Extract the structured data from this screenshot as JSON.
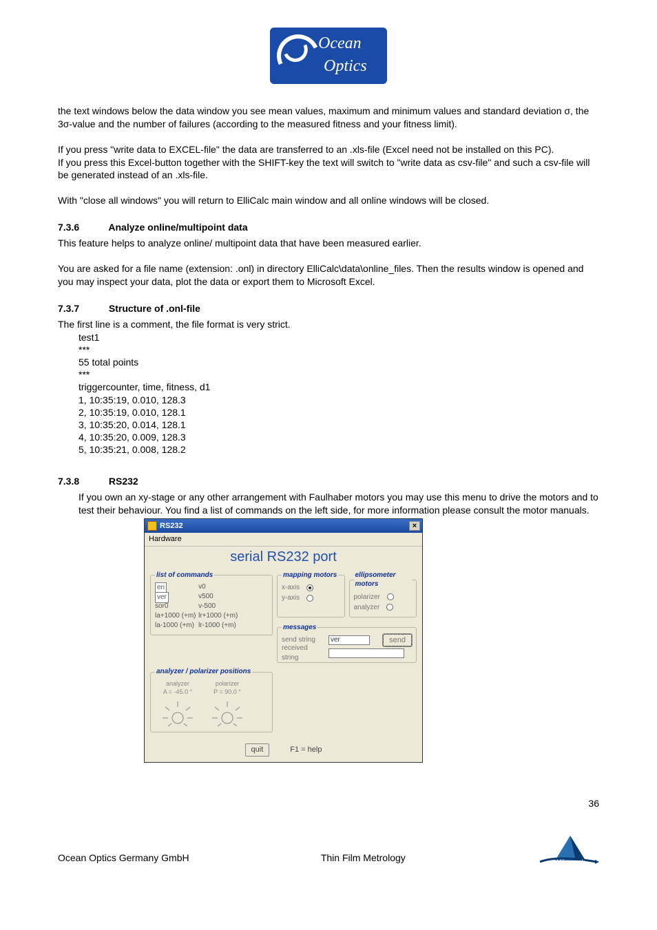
{
  "logo": {
    "line1": "Ocean",
    "line2": "Optics"
  },
  "body": {
    "para1": "the text windows below the data window you see mean values, maximum and minimum values and standard deviation σ, the 3σ-value and the number of failures (according to the measured fitness and your fitness limit).",
    "para2a": "If you press \"write data to EXCEL-file\" the data are transferred to an .xls-file (Excel need not be installed on this PC).",
    "para2b": "If you press this Excel-button together with the SHIFT-key the text will switch to \"write data as csv-file\" and such a csv-file will be generated instead of an .xls-file.",
    "para3": "With \"close all windows\" you will return to ElliCalc main window and all online windows will be closed."
  },
  "sec736": {
    "num": "7.3.6",
    "title": "Analyze online/multipoint data",
    "p1": "This feature helps to analyze online/ multipoint data that have been measured earlier.",
    "p2": "You are asked for a file name (extension: .onl) in directory ElliCalc\\data\\online_files. Then the results window is opened and you may inspect your data, plot the data or export them to Microsoft Excel."
  },
  "sec737": {
    "num": "7.3.7",
    "title": "Structure of .onl-file",
    "intro": "The first line is a comment, the file format is very strict.",
    "lines": [
      "test1",
      "***",
      "55 total points",
      "***",
      "triggercounter, time, fitness, d1",
      "1, 10:35:19, 0.010, 128.3",
      "2, 10:35:19, 0.010, 128.1",
      "3, 10:35:20, 0.014, 128.1",
      "4, 10:35:20, 0.009, 128.3",
      "5, 10:35:21, 0.008, 128.2"
    ]
  },
  "sec738": {
    "num": "7.3.8",
    "title": "RS232",
    "p1": "If you own an xy-stage or any other arrangement with Faulhaber motors you may use this menu to drive the motors and to test their behaviour. You find a list of commands on the left side, for more information please consult the motor manuals."
  },
  "window": {
    "titlebar": "RS232",
    "menu": "Hardware",
    "heading": "serial RS232 port",
    "commands": {
      "legend": "list of commands",
      "col1": [
        "en",
        "ver",
        "sor0",
        "la+1000 (+m)",
        "la-1000 (+m)"
      ],
      "col2": [
        "v0",
        "v500",
        "v-500",
        "lr+1000 (+m)",
        "lr-1000 (+m)"
      ]
    },
    "mapping": {
      "legend": "mapping motors",
      "rows": [
        {
          "label": "x-axis",
          "selected": true
        },
        {
          "label": "y-axis",
          "selected": false
        }
      ]
    },
    "ellip": {
      "legend": "ellipsometer motors",
      "rows": [
        {
          "label": "polarizer",
          "selected": false
        },
        {
          "label": "analyzer",
          "selected": false
        }
      ]
    },
    "messages": {
      "legend": "messages",
      "send_label": "send string",
      "send_value": "ver",
      "recv_label": "received string",
      "send_btn": "send"
    },
    "ap": {
      "legend": "analyzer / polarizer positions",
      "analyzer_label": "analyzer",
      "analyzer_val": "A = -45.0 °",
      "polarizer_label": "polarizer",
      "polarizer_val": "P =  90.0 °"
    },
    "quit": "quit",
    "help": "F1 = help"
  },
  "footer": {
    "page": "36",
    "left": "Ocean Optics Germany GmbH",
    "center": "Thin Film Metrology",
    "brand": "Mikropack"
  }
}
